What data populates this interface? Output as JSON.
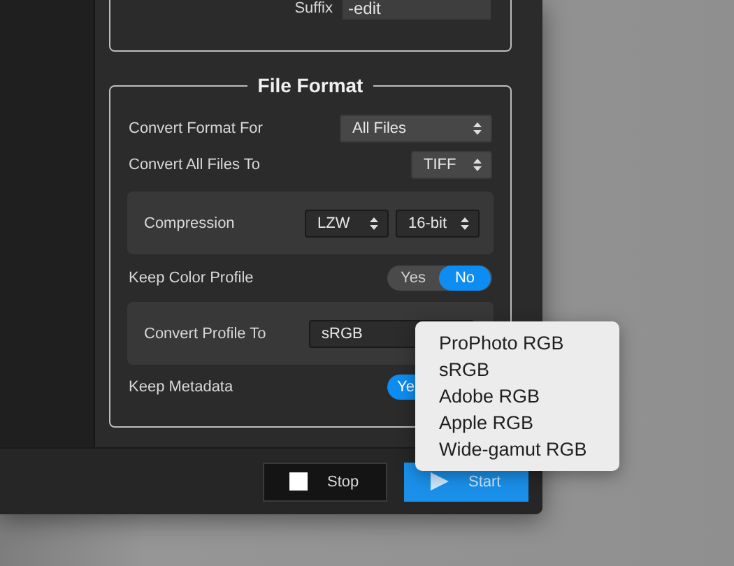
{
  "naming": {
    "suffix_label": "Suffix",
    "suffix_value": "-edit"
  },
  "file_format": {
    "title": "File Format",
    "convert_format_for": {
      "label": "Convert Format For",
      "value": "All Files"
    },
    "convert_all_files_to": {
      "label": "Convert All Files To",
      "value": "TIFF"
    },
    "compression": {
      "label": "Compression",
      "method": "LZW",
      "depth": "16-bit"
    },
    "keep_color_profile": {
      "label": "Keep Color Profile",
      "options": [
        {
          "label": "Yes",
          "selected": false
        },
        {
          "label": "No",
          "selected": true
        }
      ]
    },
    "convert_profile_to": {
      "label": "Convert Profile To",
      "value": "sRGB"
    },
    "keep_metadata": {
      "label": "Keep Metadata",
      "options": [
        {
          "label": "Ye",
          "selected": true
        }
      ]
    }
  },
  "buttons": [
    {
      "kind": "stop",
      "label": "Stop"
    },
    {
      "kind": "start",
      "label": "Start"
    }
  ],
  "profile_menu": {
    "items": [
      {
        "label": "ProPhoto RGB"
      },
      {
        "label": "sRGB"
      },
      {
        "label": "Adobe RGB"
      },
      {
        "label": "Apple RGB"
      },
      {
        "label": "Wide-gamut RGB"
      }
    ]
  }
}
